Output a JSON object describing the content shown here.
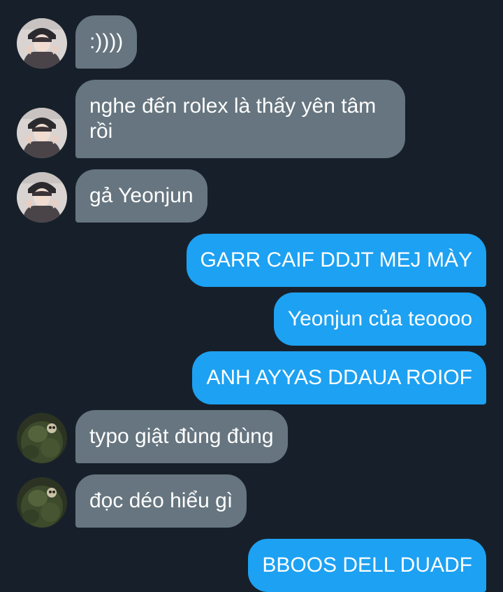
{
  "colors": {
    "background": "#17202a",
    "incoming_bubble": "#66757f",
    "outgoing_bubble": "#1da1f2",
    "text": "#ffffff"
  },
  "messages": [
    {
      "direction": "incoming",
      "avatar": "avatar-photo-person",
      "text": ":))))"
    },
    {
      "direction": "incoming",
      "avatar": "avatar-photo-person",
      "text": "nghe đến rolex là thấy yên tâm rồi"
    },
    {
      "direction": "incoming",
      "avatar": "avatar-photo-person",
      "text": "gả Yeonjun"
    },
    {
      "direction": "outgoing",
      "text": "GARR CAIF DDJT MEJ MÀY"
    },
    {
      "direction": "outgoing",
      "text": "Yeonjun của teoooo"
    },
    {
      "direction": "outgoing",
      "text": "ANH AYYAS DDAUA ROIOF"
    },
    {
      "direction": "incoming",
      "avatar": "avatar-photo-green",
      "text": "typo giật đùng đùng"
    },
    {
      "direction": "incoming",
      "avatar": "avatar-photo-green",
      "text": "đọc déo hiểu gì"
    },
    {
      "direction": "outgoing",
      "text": "BBOOS DELL DUADF"
    }
  ]
}
